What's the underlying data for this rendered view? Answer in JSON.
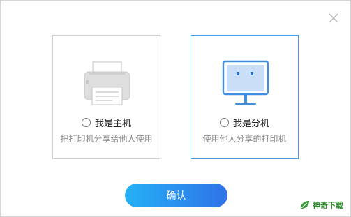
{
  "dialog": {
    "close_icon": "close-icon"
  },
  "options": [
    {
      "label": "我是主机",
      "description": "把打印机分享给他人使用",
      "icon": "printer-icon",
      "selected": false
    },
    {
      "label": "我是分机",
      "description": "使用他人分享的打印机",
      "icon": "monitor-icon",
      "selected": false,
      "highlighted": true
    }
  ],
  "confirm_label": "确认",
  "watermark_text": "神奇下载",
  "colors": {
    "accent": "#4a98e6",
    "button_gradient_start": "#25b1f6",
    "button_gradient_end": "#2f72e8",
    "watermark": "#2f8a2f"
  }
}
